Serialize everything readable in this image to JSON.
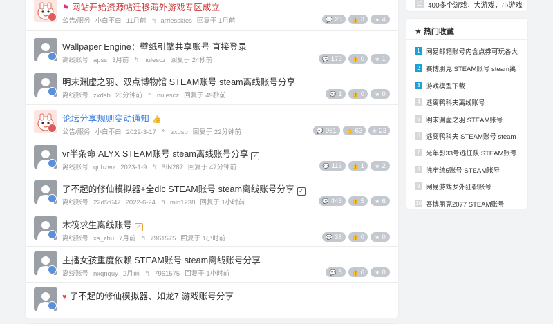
{
  "threads": [
    {
      "avatar": "mascot-avatar",
      "verified": "red",
      "prefix": "flag-icon",
      "title": "网站开始资源帖迁移海外游戏专区成立",
      "title_color": "red",
      "category": "公告/服务",
      "author": "小白不白",
      "date": "11月前",
      "last_replier": "arriesskies",
      "replied": "回复于 1月前",
      "comments": "23",
      "likes": "3",
      "stars": "4"
    },
    {
      "avatar": "default-avatar",
      "verified": "blue",
      "title": "Wallpaper Engine：壁纸引擎共享账号 直接登录",
      "title_color": "default",
      "category": "高线账号",
      "author": "apss",
      "date": "3月前",
      "last_replier": "nulescz",
      "replied": "回复于 24秒前",
      "comments": "179",
      "likes": "0",
      "stars": "1"
    },
    {
      "avatar": "default-avatar",
      "verified": "blue",
      "title": "明末渊虚之羽、双点博物馆 STEAM账号 steam离线账号分享",
      "title_color": "default",
      "category": "离线账号",
      "author": "zxdsb",
      "date": "25分钟前",
      "last_replier": "nulescz",
      "replied": "回复于 49秒前",
      "comments": "1",
      "likes": "0",
      "stars": "0"
    },
    {
      "avatar": "mascot-avatar",
      "verified": "red",
      "title": "论坛分享规则变动通知",
      "title_color": "blue",
      "suffix": "thumbs-up-icon",
      "category": "公告/服务",
      "author": "小白不白",
      "date": "2022-3-17",
      "last_replier": "zxdsb",
      "replied": "回复于 22分钟前",
      "comments": "961",
      "likes": "63",
      "stars": "23"
    },
    {
      "avatar": "default-avatar",
      "verified": "blue",
      "title": "vr半条命 ALYX STEAM账号 steam离线账号分享",
      "title_color": "default",
      "suffix": "check-icon",
      "category": "离线账号",
      "author": "qnhzwz",
      "date": "2023-1-9",
      "last_replier": "BIN287",
      "replied": "回复于 47分钟前",
      "comments": "116",
      "likes": "1",
      "stars": "2"
    },
    {
      "avatar": "default-avatar",
      "verified": "blue",
      "title": "了不起的修仙模拟器+全dlc STEAM账号 steam离线账号分享",
      "title_color": "default",
      "suffix": "check-icon",
      "category": "离线账号",
      "author": "22d5f647",
      "date": "2022-6-24",
      "last_replier": "min1238",
      "replied": "回复于 1小时前",
      "comments": "445",
      "likes": "5",
      "stars": "6"
    },
    {
      "avatar": "default-avatar",
      "verified": "blue",
      "title": "木筏求生离线账号",
      "title_color": "default",
      "suffix": "check-orange-icon",
      "category": "离线账号",
      "author": "xs_zhu",
      "date": "7月前",
      "last_replier": "7961575",
      "replied": "回复于 1小时前",
      "comments": "38",
      "likes": "0",
      "stars": "0"
    },
    {
      "avatar": "default-avatar",
      "verified": "blue",
      "title": "主播女孩重度依赖 STEAM账号 steam离线账号分享",
      "title_color": "default",
      "category": "离线账号",
      "author": "nxqnquy",
      "date": "2月前",
      "last_replier": "7961575",
      "replied": "回复于 1小时前",
      "comments": "5",
      "likes": "0",
      "stars": "0"
    },
    {
      "avatar": "default-avatar",
      "verified": "blue",
      "prefix": "heart-icon",
      "title": "了不起的修仙模拟器、如龙7 游戏账号分享",
      "title_color": "default",
      "category": "",
      "author": "",
      "date": "",
      "last_replier": "",
      "replied": "",
      "comments": "",
      "likes": "",
      "stars": ""
    }
  ],
  "sidebar_top": {
    "num": "10",
    "text": "400多个游戏，大游戏，小游戏"
  },
  "hot": {
    "title": "热门收藏",
    "items": [
      {
        "n": "1",
        "t": "网易邮箱账号内含点券可玩各大"
      },
      {
        "n": "2",
        "t": "赛博朋克 STEAM账号 steam离"
      },
      {
        "n": "3",
        "t": "游戏模型下载"
      },
      {
        "n": "4",
        "t": "逃离鸭科夫离线账号"
      },
      {
        "n": "5",
        "t": "明末渊虚之羽 STEAM账号"
      },
      {
        "n": "6",
        "t": "逃离鸭科夫 STEAM账号 steam"
      },
      {
        "n": "7",
        "t": "光年影33号远征队 STEAM账号"
      },
      {
        "n": "8",
        "t": "洗牢统5账号 STEAM账号"
      },
      {
        "n": "9",
        "t": "网易游戏罗外狂都账号"
      },
      {
        "n": "10",
        "t": "赛博朋克2077 STEAM账号"
      }
    ]
  },
  "colors": {
    "accent": "#1aa2d8",
    "pill": "#c4c8cf",
    "link_blue": "#3a7ee0",
    "alert_red": "#d0383a"
  }
}
